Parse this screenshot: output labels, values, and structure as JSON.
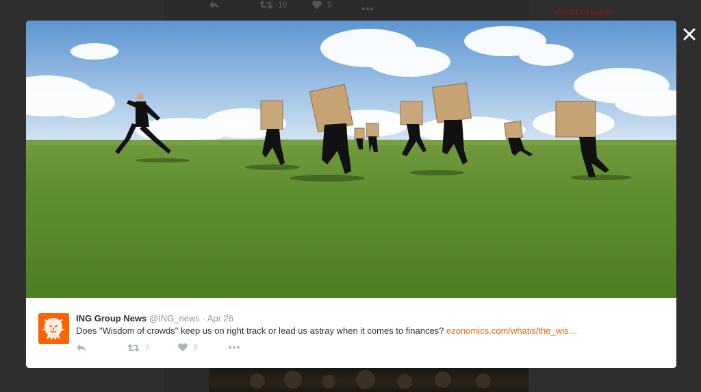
{
  "background_tweet": {
    "retweet_count": "10",
    "like_count": "9",
    "hashtag": "#WIREDHealth"
  },
  "tweet": {
    "author_name": "ING Group News",
    "handle": "@ING_news",
    "separator": "·",
    "date": "Apr 26",
    "text": "Does \"Wisdom of crowds\" keep us on right track or lead us astray when it comes to finances?",
    "link": "ezonomics.com/whatis/the_wis…",
    "retweet_count": "7",
    "like_count": "3"
  },
  "colors": {
    "brand_orange": "#ff6200",
    "link": "#e8630a",
    "action_gray": "#aab8c2",
    "overlay": "#2b2b2b"
  },
  "icons": [
    "reply-icon",
    "retweet-icon",
    "heart-icon",
    "more-icon",
    "close-icon",
    "ing-lion-icon"
  ]
}
